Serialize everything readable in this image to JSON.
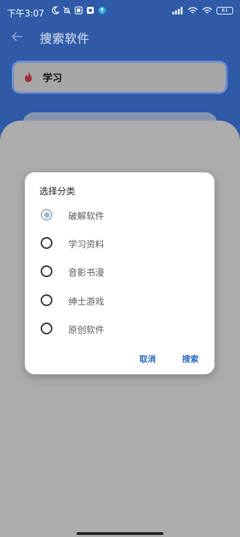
{
  "status_bar": {
    "time": "下午3:07",
    "battery": "81"
  },
  "header": {
    "title": "搜索软件"
  },
  "search": {
    "value": "学习"
  },
  "dialog": {
    "title": "选择分类",
    "options": [
      {
        "label": "破解软件",
        "selected": true
      },
      {
        "label": "学习资料",
        "selected": false
      },
      {
        "label": "音影书漫",
        "selected": false
      },
      {
        "label": "绅士游戏",
        "selected": false
      },
      {
        "label": "原创软件",
        "selected": false
      }
    ],
    "cancel_label": "取消",
    "search_label": "搜索"
  },
  "colors": {
    "primary": "#2e5aa8",
    "accent_text": "#2a6cc2",
    "scrim": "#adadad",
    "dialog_bg": "#ffffff"
  },
  "icons": {
    "back": "arrow-left-icon",
    "search_prefix": "fire-icon"
  }
}
